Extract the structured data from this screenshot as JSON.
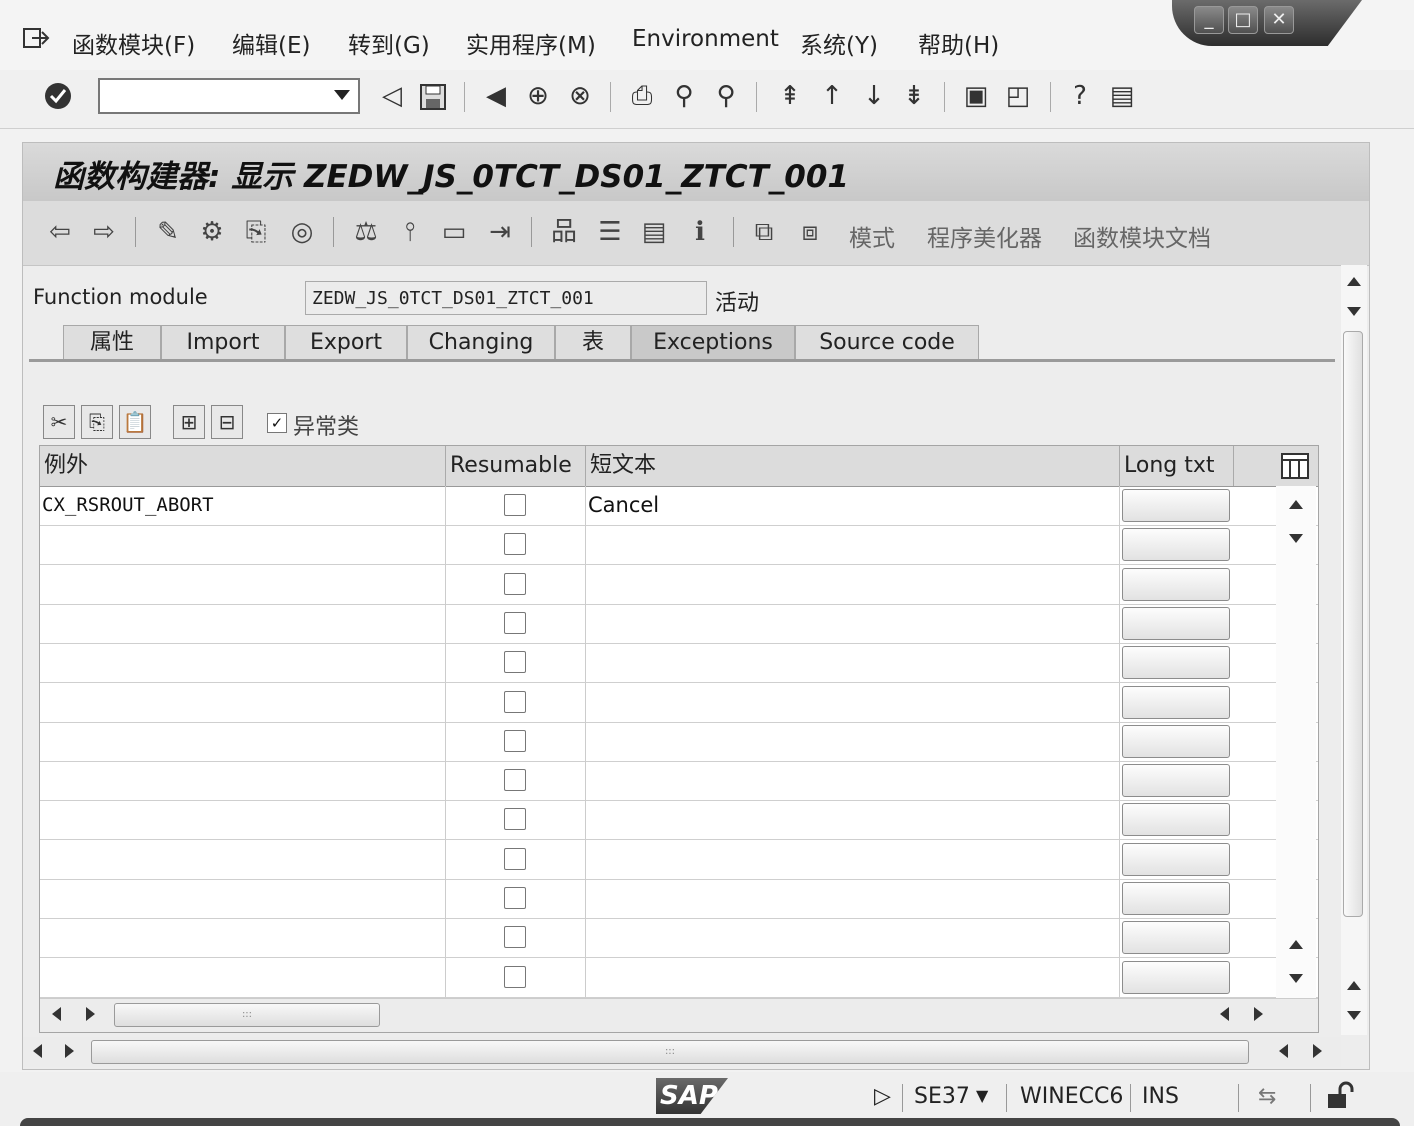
{
  "menu": {
    "items": [
      "函数模块(F)",
      "编辑(E)",
      "转到(G)",
      "实用程序(M)",
      "Environment",
      "系统(Y)",
      "帮助(H)"
    ]
  },
  "window_controls": {
    "minimize": "_",
    "maximize": "□",
    "close": "✕"
  },
  "toolbar": {
    "command_field_value": ""
  },
  "screen": {
    "title": "函数构建器: 显示 ZEDW_JS_0TCT_DS01_ZTCT_001"
  },
  "app_toolbar": {
    "text_buttons": [
      "模式",
      "程序美化器",
      "函数模块文档"
    ]
  },
  "function_module": {
    "label": "Function module",
    "value": "ZEDW_JS_0TCT_DS01_ZTCT_001",
    "status": "活动"
  },
  "tabs": [
    {
      "label": "属性",
      "active": false
    },
    {
      "label": "Import",
      "active": false
    },
    {
      "label": "Export",
      "active": false
    },
    {
      "label": "Changing",
      "active": false
    },
    {
      "label": "表",
      "active": false
    },
    {
      "label": "Exceptions",
      "active": true
    },
    {
      "label": "Source code",
      "active": false
    }
  ],
  "table_toolbar": {
    "exception_class_label": "异常类",
    "exception_class_checked": true
  },
  "table": {
    "columns": [
      "例外",
      "Resumable",
      "短文本",
      "Long txt"
    ],
    "rows": [
      {
        "exception": "CX_RSROUT_ABORT",
        "resumable": false,
        "short_text": "Cancel"
      },
      {
        "exception": "",
        "resumable": false,
        "short_text": ""
      },
      {
        "exception": "",
        "resumable": false,
        "short_text": ""
      },
      {
        "exception": "",
        "resumable": false,
        "short_text": ""
      },
      {
        "exception": "",
        "resumable": false,
        "short_text": ""
      },
      {
        "exception": "",
        "resumable": false,
        "short_text": ""
      },
      {
        "exception": "",
        "resumable": false,
        "short_text": ""
      },
      {
        "exception": "",
        "resumable": false,
        "short_text": ""
      },
      {
        "exception": "",
        "resumable": false,
        "short_text": ""
      },
      {
        "exception": "",
        "resumable": false,
        "short_text": ""
      },
      {
        "exception": "",
        "resumable": false,
        "short_text": ""
      },
      {
        "exception": "",
        "resumable": false,
        "short_text": ""
      },
      {
        "exception": "",
        "resumable": false,
        "short_text": ""
      }
    ]
  },
  "statusbar": {
    "logo": "SAP",
    "transaction": "SE37",
    "server": "WINECC6",
    "mode": "INS"
  }
}
